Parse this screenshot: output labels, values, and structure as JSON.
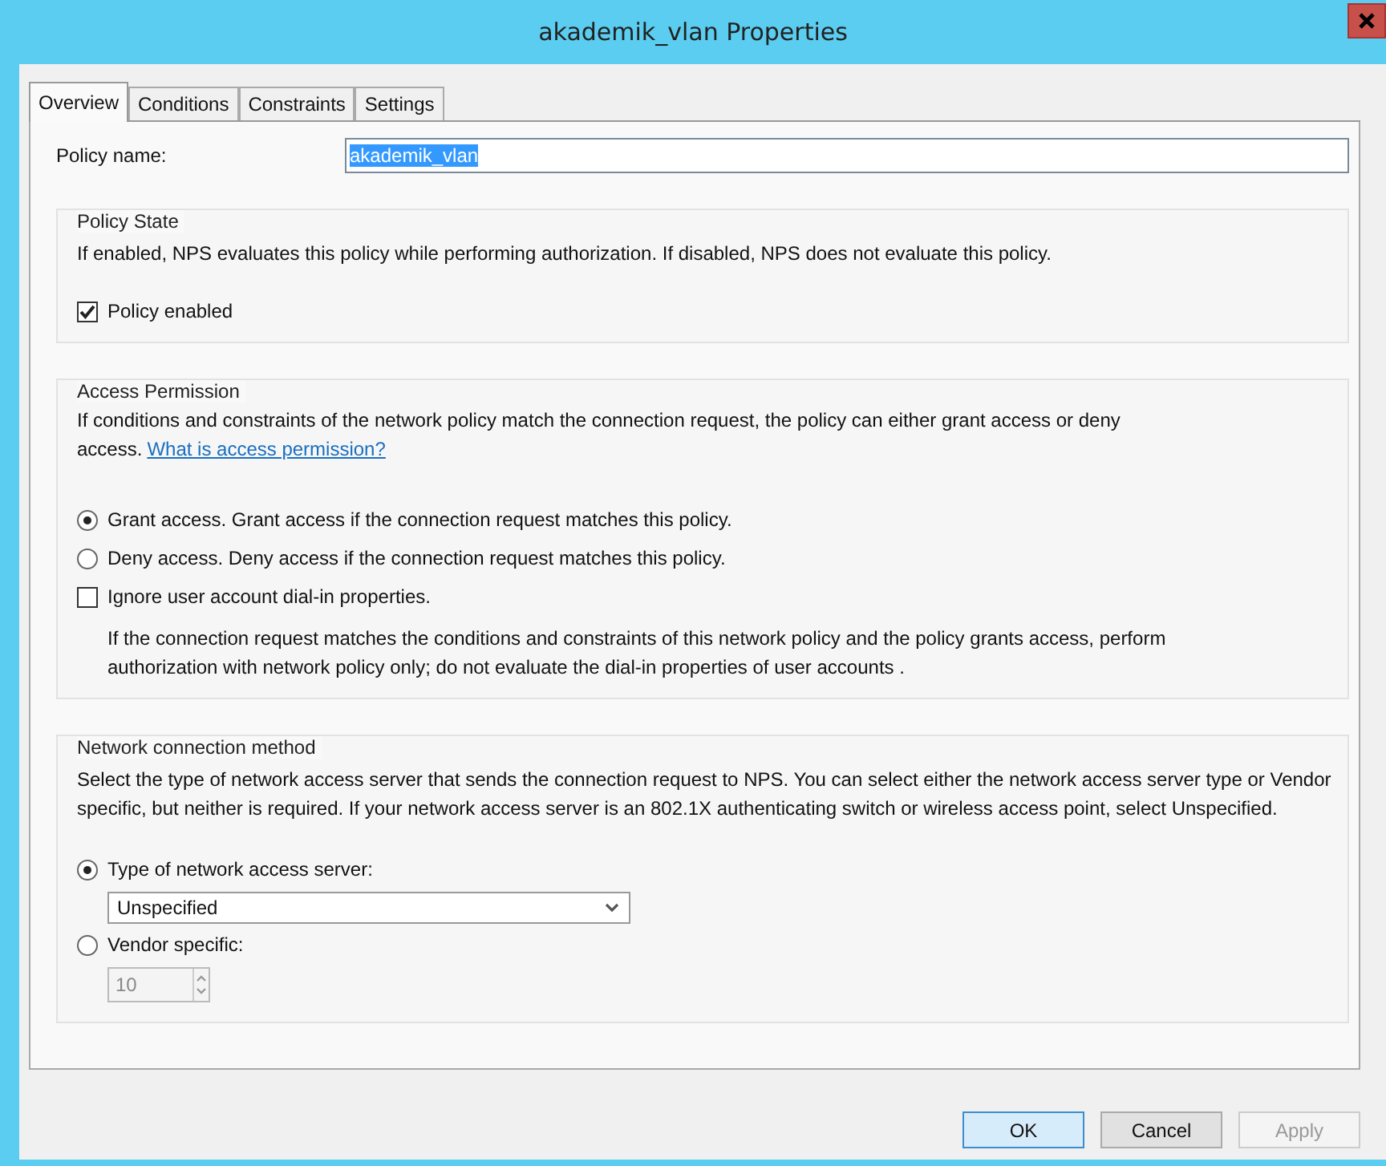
{
  "window": {
    "title": "akademik_vlan Properties"
  },
  "tabs": [
    {
      "label": "Overview",
      "selected": true
    },
    {
      "label": "Conditions",
      "selected": false
    },
    {
      "label": "Constraints",
      "selected": false
    },
    {
      "label": "Settings",
      "selected": false
    }
  ],
  "policy_name": {
    "label": "Policy name:",
    "value": "akademik_vlan"
  },
  "policy_state": {
    "title": "Policy State",
    "description": "If enabled, NPS evaluates this policy while performing authorization. If disabled, NPS does not evaluate this policy.",
    "checkbox": {
      "label": "Policy enabled",
      "checked": true
    }
  },
  "access_permission": {
    "title": "Access Permission",
    "description": "If conditions and constraints of the network policy match the connection request, the policy can either grant access or deny access.",
    "link": "What is access permission?",
    "options": [
      {
        "label": "Grant access. Grant access if the connection request matches this policy.",
        "selected": true
      },
      {
        "label": "Deny access. Deny access if the connection request matches this policy.",
        "selected": false
      }
    ],
    "ignore": {
      "label": "Ignore user account dial-in properties.",
      "checked": false,
      "note": "If the connection request matches the conditions and constraints of this network policy and the policy grants access, perform authorization with network policy only; do not evaluate the dial-in properties of user accounts ."
    }
  },
  "network_connection_method": {
    "title": "Network connection method",
    "description": "Select the type of network access server that sends the connection request to NPS. You can select either the network access server type or Vendor specific, but neither is required.  If your network access server is an 802.1X authenticating switch or wireless access point, select Unspecified.",
    "type_option": {
      "label": "Type of network access server:",
      "selected": true
    },
    "server_type": {
      "value": "Unspecified"
    },
    "vendor_option": {
      "label": "Vendor specific:",
      "selected": false
    },
    "vendor_value": {
      "value": "10",
      "disabled": true
    }
  },
  "buttons": [
    {
      "label": "OK",
      "kind": "default",
      "disabled": false
    },
    {
      "label": "Cancel",
      "kind": "normal",
      "disabled": false
    },
    {
      "label": "Apply",
      "kind": "normal",
      "disabled": true
    }
  ]
}
